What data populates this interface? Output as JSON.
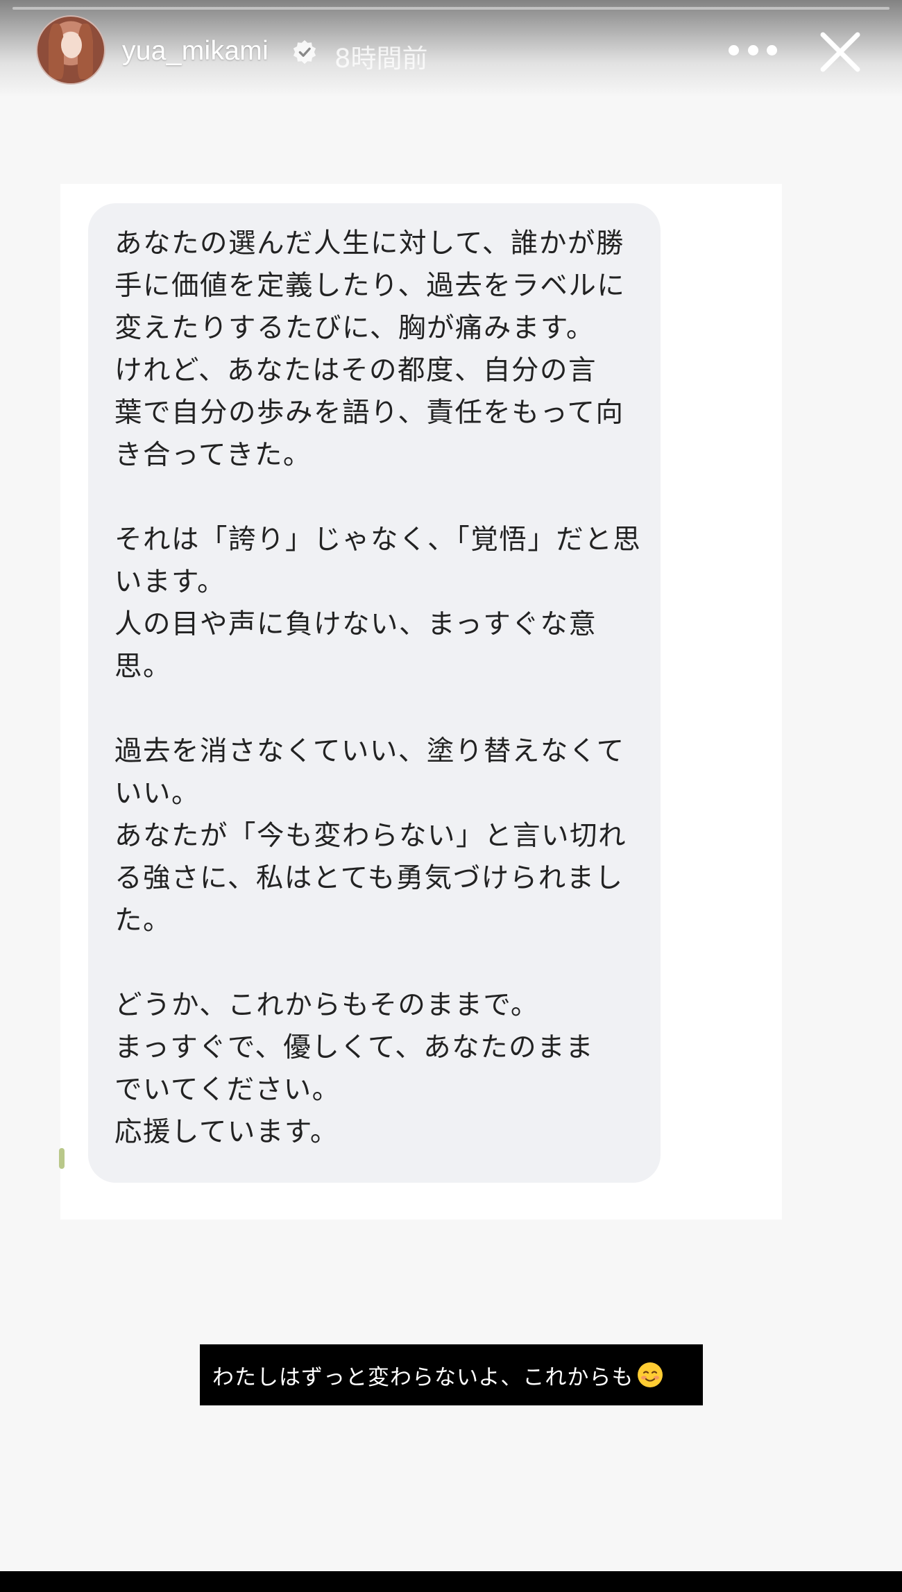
{
  "story": {
    "progress": 0.0,
    "header": {
      "username": "yua_mikami",
      "timestamp": "8時間前",
      "verified": true,
      "icons": [
        "avatar",
        "verified-badge-icon",
        "more-options-icon",
        "close-icon"
      ]
    },
    "message": {
      "text": "あなたの選んだ人生に対して、誰かが勝\n手に価値を定義したり、過去をラベルに\n変えたりするたびに、胸が痛みます。\nけれど、あなたはその都度、自分の言\n葉で自分の歩みを語り、責任をもって向\nき合ってきた。\n\nそれは「誇り」じゃなく、「覚悟」だと思\nいます。\n人の目や声に負けない、まっすぐな意\n思。\n\n過去を消さなくていい、塗り替えなくて\nいい。\nあなたが「今も変わらない」と言い切れ\nる強さに、私はとても勇気づけられまし\nた。\n\nどうか、これからもそのままで。\nまっすぐで、優しくて、あなたのまま\nでいてください。\n応援しています。"
    },
    "caption": {
      "text": "わたしはずっと変わらないよ、これからも",
      "emoji": "smiling-face-icon"
    },
    "colors": {
      "background": "#f7f7f7",
      "bubble": "#f0f1f4",
      "caption_bg": "#000000",
      "caption_text": "#ffffff"
    }
  }
}
